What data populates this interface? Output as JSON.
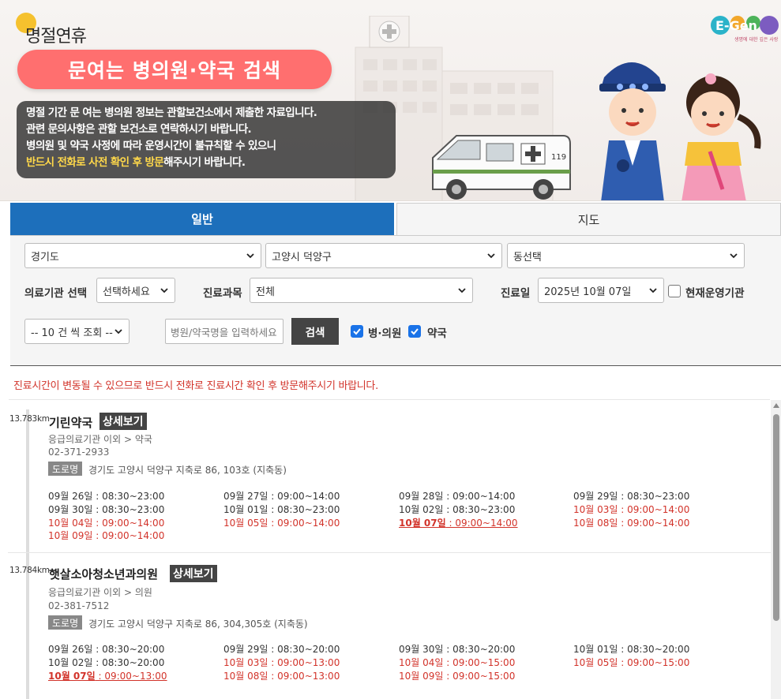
{
  "banner": {
    "small_title": "명절연휴",
    "main_title": "문여는 병의원·약국 검색",
    "notice_line1": "명절 기간 문 여는 병의원 정보는 관할보건소에서 제출한 자료입니다.",
    "notice_line2": "관련 문의사항은 관할 보건소로 연락하시기 바랍니다.",
    "notice_line3": "병의원 및 약국 사정에 따라 운영시간이 불규칙할 수 있으니",
    "notice_line4_highlight": "반드시 전화로 사전 확인 후 방문",
    "notice_line4_rest": "해주시기 바랍니다.",
    "logo_text": "E-Gen",
    "logo_tagline": "생명에 대한 깊은 사랑",
    "ambulance_label": "119"
  },
  "tabs": [
    {
      "label": "일반",
      "active": true
    },
    {
      "label": "지도",
      "active": false
    }
  ],
  "search": {
    "province": "경기도",
    "city": "고양시 덕양구",
    "dong": "동선택",
    "facility_label": "의료기관 선택",
    "facility_value": "선택하세요",
    "dept_label": "진료과목",
    "dept_value": "전체",
    "date_label": "진료일",
    "date_value": "2025년 10월 07일",
    "open_now_label": "현재운영기관",
    "page_size": "-- 10 건 씩 조회 --",
    "name_placeholder": "병원/약국명을 입력하세요",
    "search_button": "검색",
    "hospital_label": "병·의원",
    "pharmacy_label": "약국"
  },
  "warning": "진료시간이 변동될 수 있으므로 반드시 전화로 진료시간 확인 후 방문해주시기 바랍니다.",
  "results": [
    {
      "distance": "13.783km",
      "name": "기린약국",
      "detail_button": "상세보기",
      "category": "응급의료기관 이외 > 약국",
      "phone": "02-371-2933",
      "addr_tag": "도로명",
      "address": "경기도 고양시 덕양구 지축로 86, 103호 (지축동)",
      "hours": [
        {
          "date": "09월 26일",
          "time": " : 08:30~23:00",
          "style": "normal"
        },
        {
          "date": "09월 27일",
          "time": " : 09:00~14:00",
          "style": "normal"
        },
        {
          "date": "09월 28일",
          "time": " : 09:00~14:00",
          "style": "normal"
        },
        {
          "date": "09월 29일",
          "time": " : 08:30~23:00",
          "style": "normal"
        },
        {
          "date": "09월 30일",
          "time": " : 08:30~23:00",
          "style": "normal"
        },
        {
          "date": "10월 01일",
          "time": " : 08:30~23:00",
          "style": "normal"
        },
        {
          "date": "10월 02일",
          "time": " : 08:30~23:00",
          "style": "normal"
        },
        {
          "date": "10월 03일",
          "time": " : 09:00~14:00",
          "style": "red"
        },
        {
          "date": "10월 04일",
          "time": " : 09:00~14:00",
          "style": "red"
        },
        {
          "date": "10월 05일",
          "time": " : 09:00~14:00",
          "style": "red"
        },
        {
          "date": "10월 07일",
          "time": " : 09:00~14:00",
          "style": "today"
        },
        {
          "date": "10월 08일",
          "time": " : 09:00~14:00",
          "style": "red"
        },
        {
          "date": "10월 09일",
          "time": " : 09:00~14:00",
          "style": "red"
        }
      ]
    },
    {
      "distance": "13.784km",
      "name": "햇살소아청소년과의원",
      "detail_button": "상세보기",
      "category": "응급의료기관 이외 > 의원",
      "phone": "02-381-7512",
      "addr_tag": "도로명",
      "address": "경기도 고양시 덕양구 지축로 86, 304,305호 (지축동)",
      "hours": [
        {
          "date": "09월 26일",
          "time": " : 08:30~20:00",
          "style": "normal"
        },
        {
          "date": "09월 29일",
          "time": " : 08:30~20:00",
          "style": "normal"
        },
        {
          "date": "09월 30일",
          "time": " : 08:30~20:00",
          "style": "normal"
        },
        {
          "date": "10월 01일",
          "time": " : 08:30~20:00",
          "style": "normal"
        },
        {
          "date": "10월 02일",
          "time": " : 08:30~20:00",
          "style": "normal"
        },
        {
          "date": "10월 03일",
          "time": " : 09:00~13:00",
          "style": "red"
        },
        {
          "date": "10월 04일",
          "time": " : 09:00~15:00",
          "style": "red"
        },
        {
          "date": "10월 05일",
          "time": " : 09:00~15:00",
          "style": "red"
        },
        {
          "date": "10월 07일",
          "time": " : 09:00~13:00",
          "style": "today"
        },
        {
          "date": "10월 08일",
          "time": " : 09:00~13:00",
          "style": "red"
        },
        {
          "date": "10월 09일",
          "time": " : 09:00~15:00",
          "style": "red"
        }
      ]
    }
  ]
}
